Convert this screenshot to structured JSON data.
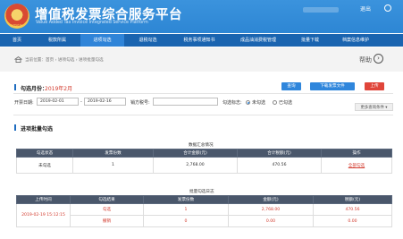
{
  "header": {
    "title_cn": "增值税发票综合服务平台",
    "title_en": "Value Added Tax Invoice Integrated Service Platform",
    "emblem_caption": "中国税务",
    "logout_label": "退出"
  },
  "nav": {
    "items": [
      {
        "label": "首页",
        "active": false
      },
      {
        "label": "税款所属",
        "active": false
      },
      {
        "label": "进项勾选",
        "active": true
      },
      {
        "label": "退税勾选",
        "active": false
      },
      {
        "label": "税务事项通知书",
        "active": false
      },
      {
        "label": "成品油消费税管理",
        "active": false
      },
      {
        "label": "批量下载",
        "active": false
      },
      {
        "label": "档案信息维护",
        "active": false
      }
    ]
  },
  "breadcrumb": {
    "text": "当前位置：首页 › 进项勾选 › 进项批量勾选",
    "help_label": "帮助"
  },
  "month_bar": {
    "label": "勾选月份：",
    "value": "2019年2月",
    "btn_query": "查询",
    "btn_download": "下载发票文件",
    "btn_upload": "上传"
  },
  "filters": {
    "start_label": "开票日期:",
    "start_value": "2019-02-01",
    "end_value": "2019-02-16",
    "seller_label": "销方税号:",
    "seller_value": "",
    "status_label": "勾选标志:",
    "opt_unchecked": "未勾选",
    "opt_checked": "已勾选",
    "more_label": "更多查询条件 ▾"
  },
  "section": {
    "title": "进项批量勾选",
    "summary_caption": "数据汇总情况",
    "upload_caption": "批量勾选日志"
  },
  "summary_table": {
    "headers": [
      "勾选状态",
      "发票份数",
      "合计金额(元)",
      "合计税额(元)",
      "操作"
    ],
    "rows": [
      {
        "status": "未勾选",
        "count": "1",
        "amount": "2,768.00",
        "tax": "470.56",
        "action": "全部勾选"
      }
    ]
  },
  "upload_table": {
    "headers": [
      "上传时间",
      "勾选结果",
      "发票份数",
      "金额(元)",
      "税额(元)"
    ],
    "rows": [
      {
        "time": "2019-02-19 15:12:15",
        "result": "勾选",
        "count": "1",
        "amount": "2,768.00",
        "tax": "470.56"
      },
      {
        "time": "",
        "result": "撤销",
        "count": "0",
        "amount": "0.00",
        "tax": "0.00"
      }
    ]
  },
  "colors": {
    "header_blue": "#2d86d4",
    "nav_blue": "#1a64b0",
    "accent_blue": "#2f86dc",
    "accent_red": "#e0453a",
    "table_header": "#4a576b"
  }
}
